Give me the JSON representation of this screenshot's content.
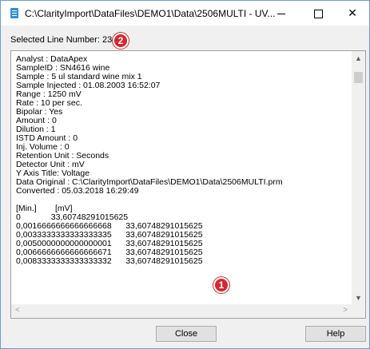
{
  "window": {
    "title": "C:\\ClarityImport\\DataFiles\\DEMO1\\Data\\2506MULTI - UV...",
    "minimize_glyph": "—",
    "close_glyph": "✕"
  },
  "selected_line_label": "Selected Line Number: 23",
  "callouts": {
    "one": "1",
    "two": "2"
  },
  "content_lines": [
    "Analyst : DataApex",
    "SampleID : SN4616 wine",
    "Sample : 5 ul standard wine mix 1",
    "Sample Injected : 01.08.2003 16:52:07",
    "Range : 1250 mV",
    "Rate : 10 per sec.",
    "Bipolar : Yes",
    "Amount : 0",
    "Dilution : 1",
    "ISTD Amount : 0",
    "Inj. Volume : 0",
    "Retention Unit : Seconds",
    "Detector Unit : mV",
    "Y Axis Title: Voltage",
    "Data Original : C:\\ClarityImport\\DataFiles\\DEMO1\\Data\\2506MULTI.prm",
    "Converted : 05.03.2018 16:29:49",
    "",
    "[Min.]        [mV]",
    "0             33,60748291015625",
    "0,0016666666666666668      33,60748291015625",
    "0,0033333333333333335      33,60748291015625",
    "0,0050000000000000001      33,60748291015625",
    "0,0066666666666666671      33,60748291015625",
    "0,0083333333333333332      33,60748291015625"
  ],
  "scrollbar": {
    "up": "▲",
    "down": "▼",
    "left": "<",
    "right": ">"
  },
  "buttons": {
    "close": "Close",
    "help": "Help"
  }
}
